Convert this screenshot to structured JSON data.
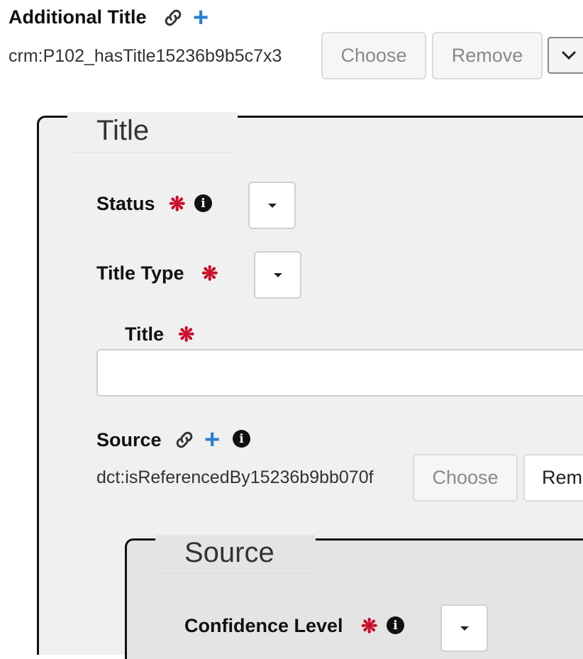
{
  "additional_title": {
    "label": "Additional Title",
    "identifier": "crm:P102_hasTitle15236b9b5c7x3",
    "choose_label": "Choose",
    "remove_label": "Remove"
  },
  "title_group": {
    "legend": "Title",
    "status": {
      "label": "Status",
      "required_mark": "❋",
      "selected": ""
    },
    "title_type": {
      "label": "Title Type",
      "required_mark": "❋",
      "selected": ""
    },
    "title_field": {
      "label": "Title",
      "required_mark": "❋",
      "value": "",
      "placeholder": ""
    },
    "source": {
      "label": "Source",
      "identifier": "dct:isReferencedBy15236b9bb070f",
      "choose_label": "Choose",
      "remove_label": "Rem"
    }
  },
  "source_group": {
    "legend": "Source",
    "confidence_level": {
      "label": "Confidence Level",
      "required_mark": "❋",
      "selected": ""
    }
  },
  "colors": {
    "required": "#c8102e",
    "plus": "#2d7fd1",
    "panel_bg": "#f0f0f0",
    "inner_panel_bg": "#e4e4e4"
  }
}
